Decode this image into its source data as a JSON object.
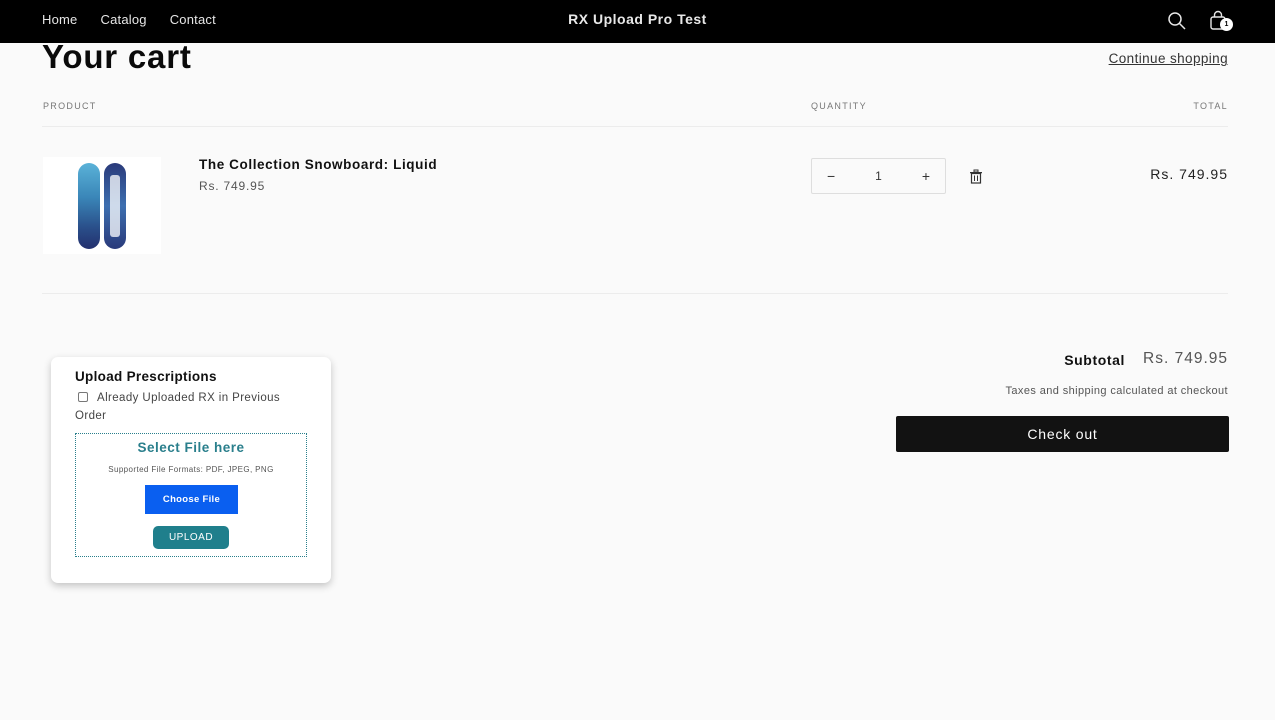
{
  "header": {
    "nav": [
      "Home",
      "Catalog",
      "Contact"
    ],
    "brand": "RX Upload Pro Test",
    "icons": {
      "search": "search-icon",
      "cart": "cart-icon"
    },
    "cart_count": "1"
  },
  "cart": {
    "title": "Your cart",
    "continue_label": "Continue shopping",
    "columns": {
      "product": "PRODUCT",
      "quantity": "QUANTITY",
      "total": "TOTAL"
    },
    "items": [
      {
        "name": "The Collection Snowboard: Liquid",
        "price": "Rs. 749.95",
        "quantity": "1",
        "line_total": "Rs. 749.95",
        "image": "snowboard-liquid"
      }
    ],
    "qty_minus": "−",
    "qty_plus": "+"
  },
  "rx_upload": {
    "title": "Upload Prescriptions",
    "checkbox_label": "Already Uploaded RX in Previous Order",
    "checkbox_checked": false,
    "drop_title": "Select File here",
    "formats": "Supported File Formats: PDF, JPEG, PNG",
    "choose_label": "Choose File",
    "upload_label": "UPLOAD",
    "accent": "#1f7f8c",
    "choose_color": "#0a5ff0"
  },
  "summary": {
    "subtotal_label": "Subtotal",
    "subtotal_value": "Rs. 749.95",
    "tax_note": "Taxes and shipping calculated at checkout",
    "checkout_label": "Check out"
  }
}
